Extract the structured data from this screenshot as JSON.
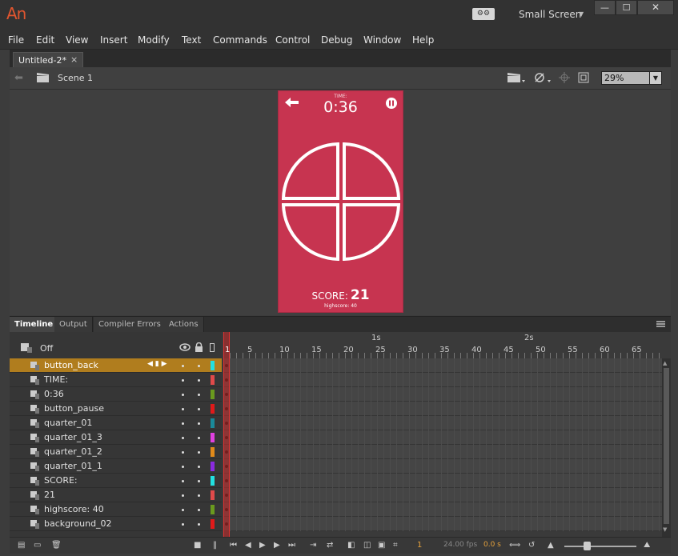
{
  "app": {
    "logo": "An"
  },
  "workspace": {
    "name": "Small Screen",
    "switch_label": "⚙⚙"
  },
  "window": {
    "minimize": "—",
    "maximize": "☐",
    "close": "✕"
  },
  "menu": [
    "File",
    "Edit",
    "View",
    "Insert",
    "Modify",
    "Text",
    "Commands",
    "Control",
    "Debug",
    "Window",
    "Help"
  ],
  "document": {
    "tab_label": "Untitled-2*",
    "close": "×"
  },
  "editbar": {
    "scene": "Scene 1",
    "zoom": "29%"
  },
  "stage": {
    "time_label": "TIME:",
    "time": "0:36",
    "score_label": "SCORE:",
    "score_value": "21",
    "highscore": "highscore: 40",
    "background_color": "#c73450"
  },
  "panel_tabs": [
    "Timeline",
    "Output",
    "Compiler Errors",
    "Actions"
  ],
  "timeline": {
    "off_label": "Off",
    "second_labels": [
      "1s",
      "2s"
    ],
    "frame_labels": [
      "5",
      "10",
      "15",
      "20",
      "25",
      "30",
      "35",
      "40",
      "45",
      "50",
      "55",
      "60",
      "65"
    ],
    "playhead_frame": "1",
    "layers": [
      {
        "name": "button_back",
        "color": "#22e0e0",
        "selected": true
      },
      {
        "name": "TIME:",
        "color": "#e04a4a"
      },
      {
        "name": "0:36",
        "color": "#6a9a1e"
      },
      {
        "name": "button_pause",
        "color": "#e01a1a"
      },
      {
        "name": "quarter_01",
        "color": "#1a8a9a"
      },
      {
        "name": "quarter_01_3",
        "color": "#e040e0"
      },
      {
        "name": "quarter_01_2",
        "color": "#e08a1a"
      },
      {
        "name": "quarter_01_1",
        "color": "#8a2ae0"
      },
      {
        "name": "SCORE:",
        "color": "#22e0e0"
      },
      {
        "name": "21",
        "color": "#e04a4a"
      },
      {
        "name": "highscore: 40",
        "color": "#6a9a1e"
      },
      {
        "name": "background_02",
        "color": "#e01a1a"
      }
    ],
    "status": {
      "current_frame": "1",
      "fps": "24.00 fps",
      "elapsed": "0.0 s"
    }
  }
}
